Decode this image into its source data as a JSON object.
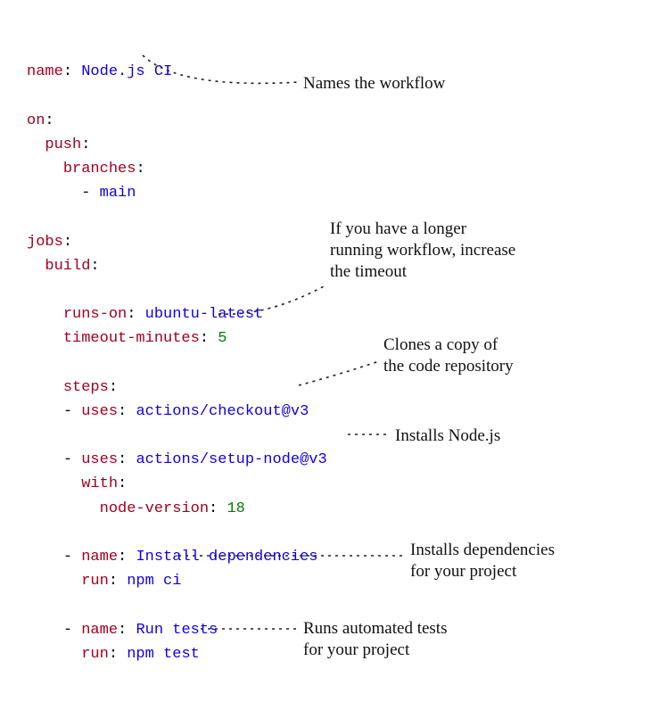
{
  "yaml": {
    "name_key": "name",
    "name_val": "Node.js CI",
    "on_key": "on",
    "push_key": "push",
    "branches_key": "branches",
    "branches_val": "main",
    "jobs_key": "jobs",
    "build_key": "build",
    "runs_on_key": "runs-on",
    "runs_on_val": "ubuntu-latest",
    "timeout_key": "timeout-minutes",
    "timeout_val": "5",
    "steps_key": "steps",
    "step1_uses_key": "uses",
    "step1_uses_val": "actions/checkout@v3",
    "step2_uses_key": "uses",
    "step2_uses_val": "actions/setup-node@v3",
    "step2_with_key": "with",
    "step2_nodever_key": "node-version",
    "step2_nodever_val": "18",
    "step3_name_key": "name",
    "step3_name_val": "Install dependencies",
    "step3_run_key": "run",
    "step3_run_val": "npm ci",
    "step4_name_key": "name",
    "step4_name_val": "Run tests",
    "step4_run_key": "run",
    "step4_run_val": "npm test"
  },
  "annot": {
    "a1": "Names the workflow",
    "a2_l1": "If you have a longer",
    "a2_l2": "running workflow, increase",
    "a2_l3": "the timeout",
    "a3_l1": "Clones a copy of",
    "a3_l2": "the code repository",
    "a4": "Installs Node.js",
    "a5_l1": "Installs dependencies",
    "a5_l2": "for your project",
    "a6_l1": "Runs automated tests",
    "a6_l2": "for your project"
  }
}
